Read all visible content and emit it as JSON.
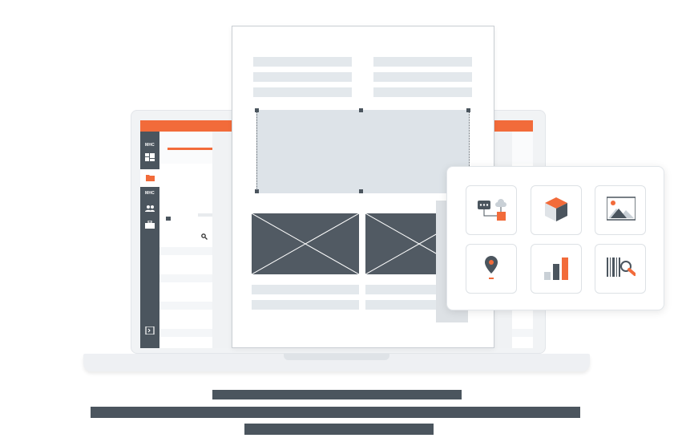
{
  "screen": {
    "sidebar": {
      "labels": [
        "MHC",
        "MHC"
      ],
      "icons": [
        "dashboard-icon",
        "folder-icon",
        "users-icon",
        "briefcase-icon",
        "collapse-icon"
      ]
    },
    "search_icon": "search-icon",
    "accent_color": "#f26b3a",
    "sidebar_color": "#4b555e"
  },
  "widgets": {
    "tiles": [
      {
        "name": "chat-flow-widget",
        "icon": "chat-flow-icon"
      },
      {
        "name": "3d-cube-widget",
        "icon": "cube-icon"
      },
      {
        "name": "image-widget",
        "icon": "image-icon"
      },
      {
        "name": "location-widget",
        "icon": "map-pin-icon"
      },
      {
        "name": "chart-widget",
        "icon": "bar-chart-icon"
      },
      {
        "name": "barcode-scan-widget",
        "icon": "barcode-search-icon"
      }
    ]
  },
  "colors": {
    "orange": "#f26b3a",
    "slate": "#4b555e",
    "placeholder": "#e3e8ec"
  }
}
